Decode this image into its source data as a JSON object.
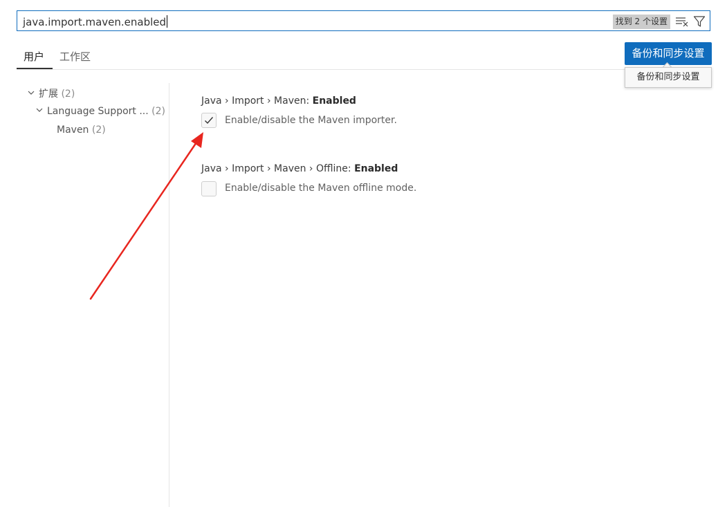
{
  "search": {
    "value": "java.import.maven.enabled",
    "results_badge": "找到 2 个设置",
    "clear_icon": "clear-filter-icon",
    "filter_icon": "filter-icon"
  },
  "tabs": [
    {
      "label": "用户",
      "active": true
    },
    {
      "label": "工作区",
      "active": false
    }
  ],
  "sync_button": {
    "label": "备份和同步设置",
    "tooltip": "备份和同步设置",
    "color": "#0f6cbd"
  },
  "toc": [
    {
      "label": "扩展",
      "count": "(2)",
      "expanded": true
    },
    {
      "label": "Language Support ...",
      "count": "(2)",
      "expanded": true
    },
    {
      "label": "Maven",
      "count": "(2)"
    }
  ],
  "settings": [
    {
      "breadcrumb": "Java › Import › Maven: ",
      "name": "Enabled",
      "description": "Enable/disable the Maven importer.",
      "checked": true
    },
    {
      "breadcrumb": "Java › Import › Maven › Offline: ",
      "name": "Enabled",
      "description": "Enable/disable the Maven offline mode.",
      "checked": false
    }
  ],
  "annotation": {
    "color": "#e8261f"
  }
}
